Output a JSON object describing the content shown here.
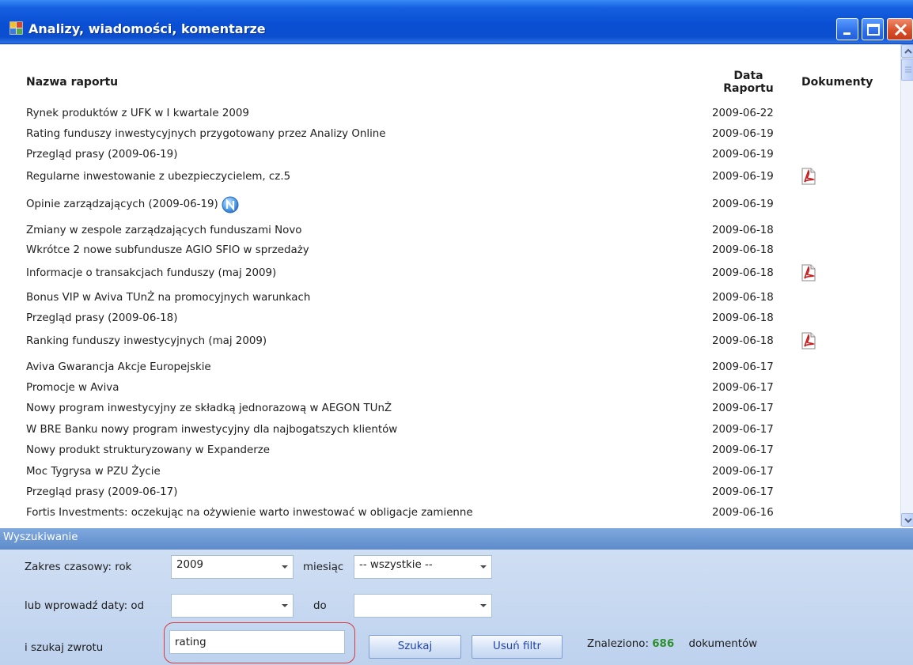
{
  "window": {
    "title": "Analizy, wiadomości, komentarze"
  },
  "table": {
    "columns": {
      "name": "Nazwa raportu",
      "date_line1": "Data",
      "date_line2": "Raportu",
      "docs": "Dokumenty"
    },
    "rows": [
      {
        "name": "Rynek produktów z UFK w I kwartale 2009",
        "date": "2009-06-22",
        "pdf": false,
        "new": false
      },
      {
        "name": "Rating funduszy inwestycyjnych przygotowany przez Analizy Online",
        "date": "2009-06-19",
        "pdf": false,
        "new": false
      },
      {
        "name": "Przegląd prasy (2009-06-19)",
        "date": "2009-06-19",
        "pdf": false,
        "new": false
      },
      {
        "name": "Regularne inwestowanie z ubezpieczycielem, cz.5",
        "date": "2009-06-19",
        "pdf": true,
        "new": false
      },
      {
        "name": "Opinie zarządzających (2009-06-19)",
        "date": "2009-06-19",
        "pdf": false,
        "new": true
      },
      {
        "name": "Zmiany w zespole zarządzających funduszami Novo",
        "date": "2009-06-18",
        "pdf": false,
        "new": false
      },
      {
        "name": "Wkrótce 2 nowe subfundusze AGIO SFIO w sprzedaży",
        "date": "2009-06-18",
        "pdf": false,
        "new": false
      },
      {
        "name": "Informacje o transakcjach funduszy (maj 2009)",
        "date": "2009-06-18",
        "pdf": true,
        "new": false
      },
      {
        "name": "Bonus VIP w Aviva TUnŻ na promocyjnych warunkach",
        "date": "2009-06-18",
        "pdf": false,
        "new": false
      },
      {
        "name": "Przegląd prasy (2009-06-18)",
        "date": "2009-06-18",
        "pdf": false,
        "new": false
      },
      {
        "name": "Ranking funduszy inwestycyjnych (maj 2009)",
        "date": "2009-06-18",
        "pdf": true,
        "new": false
      },
      {
        "name": "Aviva Gwarancja Akcje Europejskie",
        "date": "2009-06-17",
        "pdf": false,
        "new": false
      },
      {
        "name": "Promocje w Aviva",
        "date": "2009-06-17",
        "pdf": false,
        "new": false
      },
      {
        "name": "Nowy program inwestycyjny ze składką jednorazową w AEGON TUnŻ",
        "date": "2009-06-17",
        "pdf": false,
        "new": false
      },
      {
        "name": "W BRE Banku nowy program inwestycyjny dla najbogatszych klientów",
        "date": "2009-06-17",
        "pdf": false,
        "new": false
      },
      {
        "name": "Nowy produkt strukturyzowany w Expanderze",
        "date": "2009-06-17",
        "pdf": false,
        "new": false
      },
      {
        "name": "Moc Tygrysa w PZU Życie",
        "date": "2009-06-17",
        "pdf": false,
        "new": false
      },
      {
        "name": "Przegląd prasy (2009-06-17)",
        "date": "2009-06-17",
        "pdf": false,
        "new": false
      },
      {
        "name": "Fortis Investments: oczekując na ożywienie warto inwestować w obligacje zamienne",
        "date": "2009-06-16",
        "pdf": false,
        "new": false
      }
    ]
  },
  "search": {
    "panel_title": "Wyszukiwanie",
    "range_label": "Zakres czasowy: rok",
    "year_value": "2009",
    "month_label": "miesiąc",
    "month_value": "-- wszystkie --",
    "dates_label": "lub wprowadź daty: od",
    "from_value": "",
    "to_label": "do",
    "to_value": "",
    "phrase_label": "i szukaj zwrotu",
    "phrase_value": "rating",
    "search_button": "Szukaj",
    "clear_button": "Usuń filtr",
    "found_label": "Znaleziono:",
    "found_count": "686",
    "found_suffix": "dokumentów"
  }
}
